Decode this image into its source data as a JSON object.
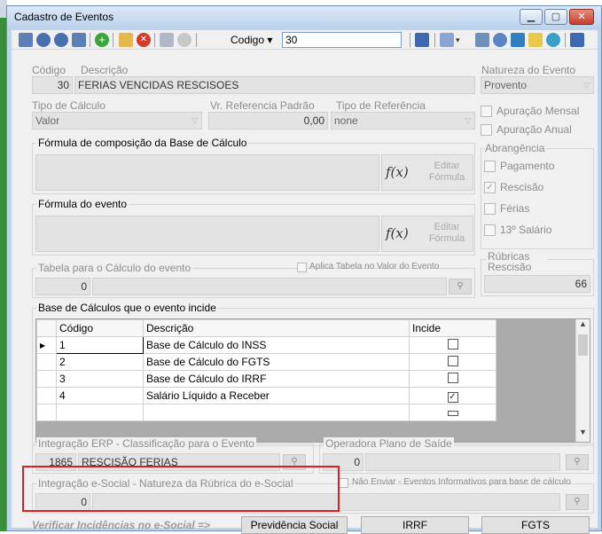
{
  "window": {
    "title": "Cadastro de Eventos"
  },
  "toolbar": {
    "codigo_label": "Codigo",
    "codigo_value": "30"
  },
  "codigo": {
    "label": "Código",
    "value": "30"
  },
  "descricao": {
    "label": "Descrição",
    "value": "FERIAS VENCIDAS RESCISOES"
  },
  "natureza": {
    "label": "Natureza do Evento",
    "value": "Provento"
  },
  "tipo_calculo": {
    "label": "Tipo de Cálculo",
    "value": "Valor"
  },
  "vr_referencia": {
    "label": "Vr. Referencia Padrão",
    "value": "0,00"
  },
  "tipo_referencia": {
    "label": "Tipo de Referência",
    "value": "none"
  },
  "apuracao_mensal": "Apuração Mensal",
  "apuracao_anual": "Apuração Anual",
  "formula_base": {
    "title": "Fórmula de composição da Base de Cálculo",
    "fx": "f(x)",
    "edit_label": "Editar Fórmula"
  },
  "formula_evento": {
    "title": "Fórmula do evento",
    "fx": "f(x)",
    "edit_label": "Editar Fórmula"
  },
  "abrangencia": {
    "title": "Abrangência",
    "items": [
      "Pagamento",
      "Rescisão",
      "Férias",
      "13º Salário"
    ],
    "checked": [
      false,
      true,
      false,
      false
    ]
  },
  "rubricas_rescisao": {
    "label": "Rúbricas Rescisão",
    "value": "66"
  },
  "tabela_calculo": {
    "title": "Tabela para o Cálculo do evento",
    "value": "0",
    "aplica_label": "Aplica Tabela no Valor do Evento"
  },
  "base_calculos": {
    "title": "Base de Cálculos que o evento incide",
    "headers": [
      "Código",
      "Descrição",
      "Incide"
    ],
    "rows": [
      {
        "codigo": "1",
        "descricao": "Base de Cálculo do INSS",
        "incide": false
      },
      {
        "codigo": "2",
        "descricao": "Base de Cálculo do FGTS",
        "incide": false
      },
      {
        "codigo": "3",
        "descricao": "Base de Cálculo do IRRF",
        "incide": false
      },
      {
        "codigo": "4",
        "descricao": "Salário Líquido a Receber",
        "incide": true
      }
    ]
  },
  "integracao_erp": {
    "title": "Integração ERP - Classificação para o Evento",
    "code": "1865",
    "value": "RESCISÃO FERIAS"
  },
  "operadora": {
    "title": "Operadora Plano de Saíde",
    "value": "0"
  },
  "esocial": {
    "title": "Integração e-Social - Natureza da Rúbrica do e-Social",
    "value": "0",
    "nao_enviar_label": "Não Enviar - Eventos Informativos para base de cálculo"
  },
  "footer": {
    "verificar_label": "Verificar Incidências no e-Social =>",
    "btn_previdencia": "Previdência Social",
    "btn_irrf": "IRRF",
    "btn_fgts": "FGTS"
  }
}
